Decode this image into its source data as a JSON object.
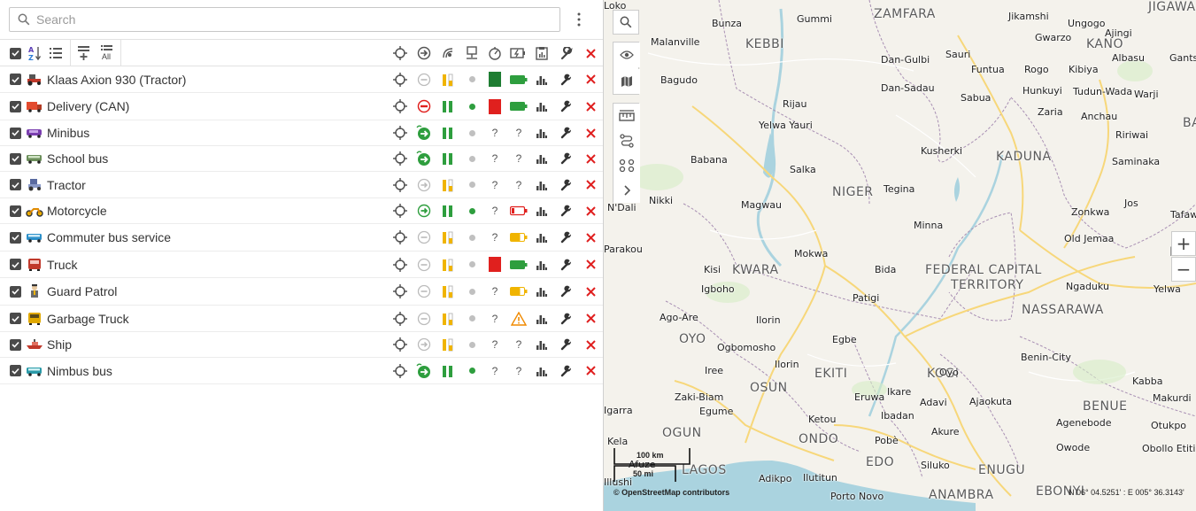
{
  "search": {
    "placeholder": "Search"
  },
  "header_icons": [
    "select-all-checkbox",
    "sort-az-icon",
    "list-icon",
    "add-group-icon",
    "all-units-icon",
    "locate-icon",
    "motion-arrow-icon",
    "gps-signal-icon",
    "connection-icon",
    "speedometer-icon",
    "power-icon",
    "report-icon",
    "service-icon",
    "delete-icon"
  ],
  "header": {
    "all_label": "All"
  },
  "colors": {
    "green": "#2e9e3e",
    "red": "#e0201e",
    "dark_green": "#1e7d32",
    "orange": "#f0b400",
    "grey": "#c0c0c0",
    "accent": "#555555"
  },
  "units": [
    {
      "name": "Klaas Axion 930 (Tractor)",
      "icon": "tractor-icon",
      "motion": "stopped",
      "sig": "yellow-bars",
      "dot": "grey",
      "connection": "dark-green-square",
      "power": "green-battery"
    },
    {
      "name": "Delivery (CAN)",
      "icon": "delivery-truck-icon",
      "motion": "no-entry",
      "sig": "green-bars",
      "dot": "green",
      "connection": "red-square",
      "power": "green-battery"
    },
    {
      "name": "Minibus",
      "icon": "minibus-icon",
      "motion": "moving",
      "sig": "green-bars",
      "dot": "grey",
      "connection": "?",
      "power": "?"
    },
    {
      "name": "School bus",
      "icon": "school-bus-icon",
      "motion": "moving",
      "sig": "green-bars",
      "dot": "grey",
      "connection": "?",
      "power": "?"
    },
    {
      "name": "Tractor",
      "icon": "tractor-2-icon",
      "motion": "arrow-grey",
      "sig": "yellow-bars",
      "dot": "grey",
      "connection": "?",
      "power": "?"
    },
    {
      "name": "Motorcycle",
      "icon": "motorcycle-icon",
      "motion": "arrow-green",
      "sig": "green-bars",
      "dot": "green",
      "connection": "?",
      "power": "red-battery"
    },
    {
      "name": "Commuter bus service",
      "icon": "commuter-bus-icon",
      "motion": "stopped",
      "sig": "yellow-bars",
      "dot": "grey",
      "connection": "?",
      "power": "yellow-battery"
    },
    {
      "name": "Truck",
      "icon": "truck-icon",
      "motion": "stopped",
      "sig": "yellow-bars",
      "dot": "grey",
      "connection": "red-square",
      "power": "green-battery"
    },
    {
      "name": "Guard Patrol",
      "icon": "guard-icon",
      "motion": "stopped",
      "sig": "yellow-bars",
      "dot": "grey",
      "connection": "?",
      "power": "yellow-battery"
    },
    {
      "name": "Garbage Truck",
      "icon": "garbage-truck-icon",
      "motion": "stopped",
      "sig": "yellow-bars",
      "dot": "grey",
      "connection": "?",
      "power": "warning"
    },
    {
      "name": "Ship",
      "icon": "ship-icon",
      "motion": "arrow-grey",
      "sig": "yellow-bars",
      "dot": "grey",
      "connection": "?",
      "power": "?"
    },
    {
      "name": "Nimbus bus",
      "icon": "bus-icon",
      "motion": "moving",
      "sig": "green-bars",
      "dot": "green",
      "connection": "?",
      "power": "?"
    }
  ],
  "map": {
    "attribution": "© OpenStreetMap contributors",
    "coordinates": "N 06° 04.5251' : E 005° 36.3143'",
    "scale_km": "100 km",
    "scale_mi": "50 mi",
    "states": [
      "ZAMFARA",
      "KEBBI",
      "KANO",
      "NIGER",
      "KADUNA",
      "KWARA",
      "FEDERAL CAPITAL",
      "TERRITORY",
      "NASSARAWA",
      "OYO",
      "OSUN",
      "EKITI",
      "KOGI",
      "BENUE",
      "OGUN",
      "ONDO",
      "EDO",
      "LAGOS",
      "ENUGU",
      "ANAMBRA",
      "EBONYI",
      "PLAT",
      "JIGAWA",
      "BA"
    ],
    "cities": [
      "Bunza",
      "Gummi",
      "Jikamshi",
      "Ungogo",
      "Gwarzo",
      "Ajingi",
      "Malanville",
      "Dan-Gulbi",
      "Sauri",
      "Funtua",
      "Rogo",
      "Kibiya",
      "Albasu",
      "Gants",
      "Bagudo",
      "Dan-Sadau",
      "Hunkuyi",
      "Tudun-Wada",
      "Warji",
      "Rijau",
      "Sabua",
      "Zaria",
      "Anchau",
      "Yelwa Yauri",
      "Kusherki",
      "Ririwai",
      "Babana",
      "Saminaka",
      "Salka",
      "Nikki",
      "Magwau",
      "Tegina",
      "Jos",
      "N'Dali",
      "Zonkwa",
      "Tafawa-Balew",
      "Minna",
      "Old Jemaa",
      "Parakou",
      "Mokwa",
      "Kisi",
      "Bida",
      "Yelwa",
      "Igboho",
      "Ngaduku",
      "Patigi",
      "Ago-Are",
      "Ilorin",
      "Ogbomosho",
      "Egbe",
      "Ilorin",
      "Iree",
      "Oyo",
      "Kabba",
      "Makurdi",
      "Zaki-Biam",
      "Eruwa",
      "Ikare",
      "Adavi",
      "Ajaokuta",
      "Egume",
      "Ibadan",
      "Igarra",
      "Ketou",
      "Akure",
      "Agenebode",
      "Otukpo",
      "Kela",
      "Pobè",
      "Afuze",
      "Owode",
      "Obollo Etiti",
      "Adikpo",
      "Ilutitun",
      "Siluko",
      "Illushi",
      "Porto Novo",
      "Benin-City",
      "Loko"
    ]
  }
}
